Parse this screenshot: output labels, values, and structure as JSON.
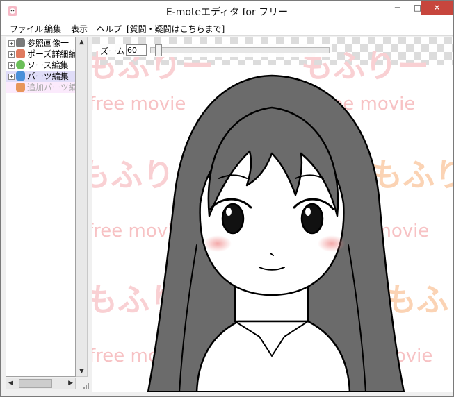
{
  "window": {
    "title": "E-moteエディタ for フリー",
    "controls": {
      "minimize": "─",
      "maximize": "□",
      "close": "✕"
    }
  },
  "menu": [
    "ファイル",
    "編集",
    "表示",
    "ヘルプ",
    "[質問・疑問はこちらまで]"
  ],
  "tree": [
    {
      "label": "参照画像一",
      "expander": "+",
      "icon": "reference-image-icon",
      "color": "#7a7a7a"
    },
    {
      "label": "ポーズ詳細編",
      "expander": "+",
      "icon": "pose-icon",
      "color": "#e07a5f"
    },
    {
      "label": "ソース編集",
      "expander": "+",
      "icon": "speech-bubble-icon",
      "color": "#6bbf59"
    },
    {
      "label": "パーツ編集",
      "expander": "+",
      "icon": "parts-icon",
      "color": "#4a90d9"
    },
    {
      "label": "追加パーツ編",
      "expander": "",
      "icon": "add-parts-icon",
      "color": "#e8965a"
    }
  ],
  "zoom": {
    "label": "ズーム",
    "value": "60"
  },
  "watermark": {
    "logo": "もふりー",
    "tagline": "free movie"
  },
  "colors": {
    "selection": "#e0ddf8",
    "hair": "#6b6b6b",
    "watermark": "#f7c9c9"
  }
}
